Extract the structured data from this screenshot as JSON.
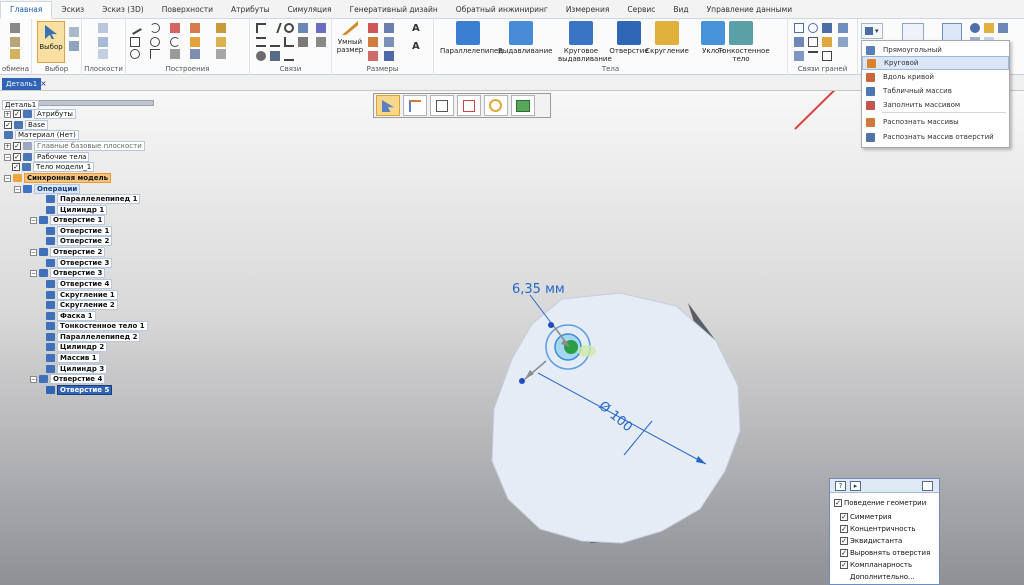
{
  "ribbon": {
    "tabs": [
      {
        "label": "Главная",
        "active": true
      },
      {
        "label": "Эскиз",
        "active": false
      },
      {
        "label": "Эскиз (3D)",
        "active": false
      },
      {
        "label": "Поверхности",
        "active": false
      },
      {
        "label": "Атрибуты",
        "active": false
      },
      {
        "label": "Симуляция",
        "active": false
      },
      {
        "label": "Генеративный дизайн",
        "active": false
      },
      {
        "label": "Обратный инжиниринг",
        "active": false
      },
      {
        "label": "Измерения",
        "active": false
      },
      {
        "label": "Сервис",
        "active": false
      },
      {
        "label": "Вид",
        "active": false
      },
      {
        "label": "Управление данными",
        "active": false
      }
    ],
    "groups": {
      "clipboard": "обмена",
      "select": "Выбор",
      "select_button": "Выбор",
      "planes": "Плоскости",
      "draw": "Построения",
      "relations": "Связи",
      "dimensions": "Размеры",
      "smart_dimension_1": "Умный",
      "smart_dimension_2": "размер",
      "solids": "Тела",
      "face_relations": "Связи граней"
    },
    "solid_buttons": [
      {
        "label": "Параллелепипед",
        "icon": "box-icon",
        "color": "#3c7fd1"
      },
      {
        "label": "Выдавливание",
        "icon": "extrude-icon",
        "color": "#4a8bd8"
      },
      {
        "label": "Круговое выдавливание",
        "icon": "revolve-icon",
        "color": "#3a74c4"
      },
      {
        "label": "Отверстие",
        "icon": "hole-icon",
        "color": "#2f67b6"
      },
      {
        "label": "Скругление",
        "icon": "round-icon",
        "color": "#e0b13a"
      },
      {
        "label": "Уклон",
        "icon": "draft-icon",
        "color": "#4793d9"
      },
      {
        "label": "Тонкостенное тело",
        "icon": "thinwall-icon",
        "color": "#5aa0a6"
      }
    ]
  },
  "document": {
    "tab_label": "Деталь1",
    "close_glyph": "×"
  },
  "tree": {
    "root": "Деталь1",
    "items": [
      {
        "label": "Атрибуты",
        "style": "plain",
        "checkbox": true,
        "twisty": "+"
      },
      {
        "label": "Base",
        "style": "plain",
        "checkbox": true,
        "twisty": ""
      },
      {
        "label": "Материал (Нет)",
        "style": "plain",
        "checkbox": false,
        "twisty": ""
      },
      {
        "label": "Главные базовые плоскости",
        "style": "gray",
        "checkbox": true,
        "twisty": "+"
      },
      {
        "label": "Рабочие тела",
        "style": "plain",
        "checkbox": true,
        "twisty": "−"
      },
      {
        "label": "Тело модели_1",
        "style": "plain",
        "checkbox": true,
        "twisty": ""
      },
      {
        "label": "Синхронная модель",
        "style": "sync",
        "checkbox": false,
        "twisty": "−"
      },
      {
        "label": "Операции",
        "style": "ops",
        "checkbox": false,
        "twisty": "−"
      },
      {
        "label": "Параллелепипед 1",
        "style": "bold",
        "checkbox": false,
        "twisty": ""
      },
      {
        "label": "Цилиндр 1",
        "style": "bold",
        "checkbox": false,
        "twisty": ""
      },
      {
        "label": "Отверстие 1",
        "style": "bold",
        "checkbox": false,
        "twisty": "−"
      },
      {
        "label": "Отверстие 1",
        "style": "bold",
        "checkbox": false,
        "twisty": ""
      },
      {
        "label": "Отверстие 2",
        "style": "bold",
        "checkbox": false,
        "twisty": ""
      },
      {
        "label": "Отверстие 2",
        "style": "bold",
        "checkbox": false,
        "twisty": "−"
      },
      {
        "label": "Отверстие 3",
        "style": "bold",
        "checkbox": false,
        "twisty": ""
      },
      {
        "label": "Отверстие 3",
        "style": "bold",
        "checkbox": false,
        "twisty": "−"
      },
      {
        "label": "Отверстие 4",
        "style": "bold",
        "checkbox": false,
        "twisty": ""
      },
      {
        "label": "Скругление 1",
        "style": "bold",
        "checkbox": false,
        "twisty": ""
      },
      {
        "label": "Скругление 2",
        "style": "bold",
        "checkbox": false,
        "twisty": ""
      },
      {
        "label": "Фаска 1",
        "style": "bold",
        "checkbox": false,
        "twisty": ""
      },
      {
        "label": "Тонкостенное тело 1",
        "style": "bold",
        "checkbox": false,
        "twisty": ""
      },
      {
        "label": "Параллелепипед 2",
        "style": "bold",
        "checkbox": false,
        "twisty": ""
      },
      {
        "label": "Цилиндр 2",
        "style": "bold",
        "checkbox": false,
        "twisty": ""
      },
      {
        "label": "Массив 1",
        "style": "bold",
        "checkbox": false,
        "twisty": ""
      },
      {
        "label": "Цилиндр 3",
        "style": "bold",
        "checkbox": false,
        "twisty": ""
      },
      {
        "label": "Отверстие 4",
        "style": "bold",
        "checkbox": false,
        "twisty": "−"
      },
      {
        "label": "Отверстие 5",
        "style": "sel",
        "checkbox": false,
        "twisty": ""
      }
    ]
  },
  "pattern_menu": {
    "items": [
      {
        "label": "Прямоугольный",
        "icon": "rect-pattern-icon",
        "color": "#5a7fb8",
        "highlighted": false
      },
      {
        "label": "Круговой",
        "icon": "circular-pattern-icon",
        "color": "#d9822b",
        "highlighted": true
      },
      {
        "label": "Вдоль кривой",
        "icon": "curve-pattern-icon",
        "color": "#c9663a",
        "highlighted": false
      },
      {
        "label": "Табличный массив",
        "icon": "table-pattern-icon",
        "color": "#4d77b0",
        "highlighted": false
      },
      {
        "label": "Заполнить массивом",
        "icon": "fill-pattern-icon",
        "color": "#c2564e",
        "highlighted": false
      },
      {
        "label": "Распознать массивы",
        "icon": "recognize-pattern-icon",
        "color": "#d1793a",
        "highlighted": false
      },
      {
        "label": "Распознать массив отверстий",
        "icon": "recognize-holes-icon",
        "color": "#4f74aa",
        "highlighted": false
      }
    ]
  },
  "viewport": {
    "hole_dimension": "6,35 мм",
    "diameter_dimension": "Ø 100",
    "accent": "#2567c9"
  },
  "geometry_panel": {
    "title": "Поведение геометрии",
    "options": [
      {
        "label": "Симметрия",
        "checked": true
      },
      {
        "label": "Концентричность",
        "checked": true
      },
      {
        "label": "Эквидистанта",
        "checked": true
      },
      {
        "label": "Выровнять отверстия",
        "checked": true
      },
      {
        "label": "Компланарность",
        "checked": true
      }
    ],
    "more": "Дополнительно...",
    "help_glyph": "?",
    "play_glyph": "▸"
  }
}
